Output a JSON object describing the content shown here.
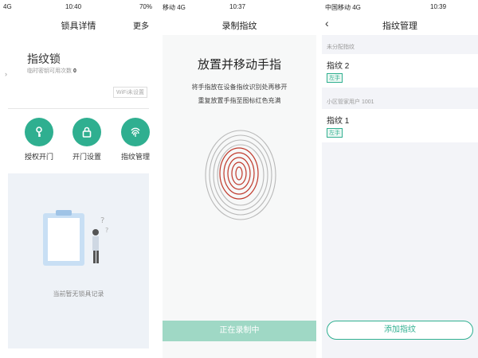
{
  "panel1": {
    "status": {
      "carrier": "4G",
      "time": "10:40",
      "battery": "70%"
    },
    "nav": {
      "title": "锁具详情",
      "more": "更多"
    },
    "lock": {
      "name": "指纹锁",
      "sub_label": "临时密钥可用次数",
      "sub_value": "0",
      "wifi_tag": "WiFi未设置"
    },
    "actions": [
      {
        "label": "授权开门",
        "icon": "key-icon"
      },
      {
        "label": "开门设置",
        "icon": "lock-icon"
      },
      {
        "label": "指纹管理",
        "icon": "fingerprint-icon"
      }
    ],
    "empty_text": "当前暂无锁具记录"
  },
  "panel2": {
    "status": {
      "carrier": "移动 4G",
      "time": "10:37"
    },
    "nav": {
      "title": "录制指纹"
    },
    "heading": "放置并移动手指",
    "instructions": [
      "将手指放在设备指纹识别处再移开",
      "重复放置手指至图标红色充满"
    ],
    "button": "正在录制中"
  },
  "panel3": {
    "status": {
      "carrier": "中国移动 4G",
      "time": "10:39"
    },
    "nav": {
      "title": "指纹管理"
    },
    "sections": [
      {
        "header": "未分配指纹",
        "items": [
          {
            "name": "指纹 2",
            "tag": "左手"
          }
        ]
      },
      {
        "header": "小区管家用户 1001",
        "items": [
          {
            "name": "指纹 1",
            "tag": "左手"
          }
        ]
      }
    ],
    "add_button": "添加指纹",
    "colors": {
      "accent": "#2faf90",
      "accent_light": "#9fd8c5"
    }
  }
}
